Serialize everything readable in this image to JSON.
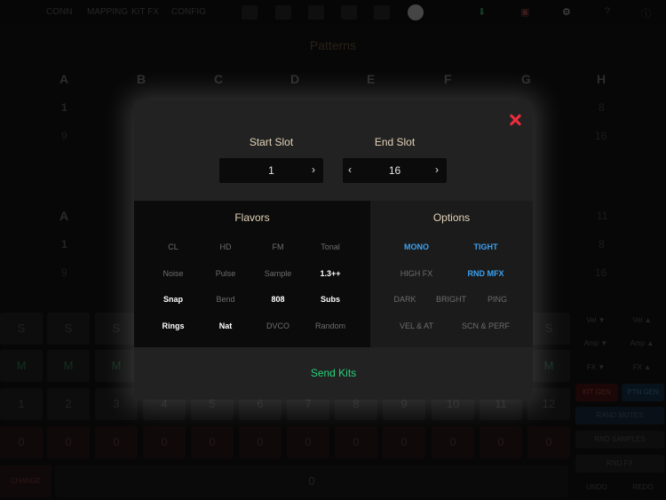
{
  "background": {
    "menu": [
      "CONN",
      "MAPPING",
      "KIT FX",
      "CONFIG"
    ],
    "patterns_title": "Patterns",
    "upper_letters": [
      "A",
      "B",
      "C",
      "D",
      "E",
      "F",
      "G",
      "H"
    ],
    "upper_first_number": "1",
    "upper_second_number": "9",
    "upper_right_numbers": [
      "8",
      "16"
    ],
    "lower_letters": [
      "A"
    ],
    "lower_first_number": "1",
    "lower_second_number": "9",
    "lower_right_numbers": [
      "11",
      "8",
      "16"
    ],
    "solo_labels": [
      "S",
      "S",
      "S",
      "S"
    ],
    "mute_labels": [
      "M",
      "M",
      "M",
      "M"
    ],
    "track_numbers": [
      "1",
      "2",
      "3",
      "4",
      "5",
      "6",
      "7",
      "8",
      "9",
      "10",
      "11",
      "12"
    ],
    "track_values": [
      "0",
      "0",
      "0",
      "0",
      "0",
      "0",
      "0",
      "0",
      "0",
      "0",
      "0",
      "0"
    ],
    "bottom_left_label": "CHANGE",
    "bottom_value": "0",
    "right_panel": {
      "vel_a": "Vel ▼",
      "vel_b": "Vel ▲",
      "amp_a": "Amp ▼",
      "amp_b": "Amp ▲",
      "fx_a": "FX ▼",
      "fx_b": "FX ▲",
      "kit_gen": "KIT GEN",
      "ptn_gen": "PTN GEN",
      "rand_mutes": "RAND MUTES",
      "rnd_samples": "RND SAMPLES",
      "rnd_fx": "RND FX",
      "undo": "UNDO",
      "redo": "REDO"
    }
  },
  "modal": {
    "start_slot": {
      "label": "Start Slot",
      "value": "1"
    },
    "end_slot": {
      "label": "End Slot",
      "value": "16"
    },
    "flavors": {
      "title": "Flavors",
      "rows": [
        [
          {
            "label": "CL",
            "state": "off"
          },
          {
            "label": "HD",
            "state": "off"
          },
          {
            "label": "FM",
            "state": "off"
          },
          {
            "label": "Tonal",
            "state": "off"
          }
        ],
        [
          {
            "label": "Noise",
            "state": "off"
          },
          {
            "label": "Pulse",
            "state": "off"
          },
          {
            "label": "Sample",
            "state": "off"
          },
          {
            "label": "1.3++",
            "state": "on"
          }
        ],
        [
          {
            "label": "Snap",
            "state": "on"
          },
          {
            "label": "Bend",
            "state": "off"
          },
          {
            "label": "808",
            "state": "on"
          },
          {
            "label": "Subs",
            "state": "on"
          }
        ],
        [
          {
            "label": "Rings",
            "state": "on"
          },
          {
            "label": "Nat",
            "state": "on"
          },
          {
            "label": "DVCO",
            "state": "off"
          },
          {
            "label": "Random",
            "state": "off"
          }
        ]
      ]
    },
    "options": {
      "title": "Options",
      "rows": [
        [
          {
            "label": "MONO",
            "state": "on"
          },
          {
            "label": "TIGHT",
            "state": "on"
          }
        ],
        [
          {
            "label": "HIGH FX",
            "state": "off"
          },
          {
            "label": "RND MFX",
            "state": "on"
          }
        ],
        [
          {
            "label": "DARK",
            "state": "off"
          },
          {
            "label": "BRIGHT",
            "state": "off"
          },
          {
            "label": "PING",
            "state": "off"
          }
        ],
        [
          {
            "label": "VEL & AT",
            "state": "off"
          },
          {
            "label": "SCN & PERF",
            "state": "off"
          }
        ]
      ]
    },
    "send_label": "Send Kits"
  },
  "colors": {
    "accent_green": "#27d17a",
    "option_blue": "#3ca1f0",
    "close_red": "#ef2d3d",
    "label_cream": "#e4d3b8"
  }
}
